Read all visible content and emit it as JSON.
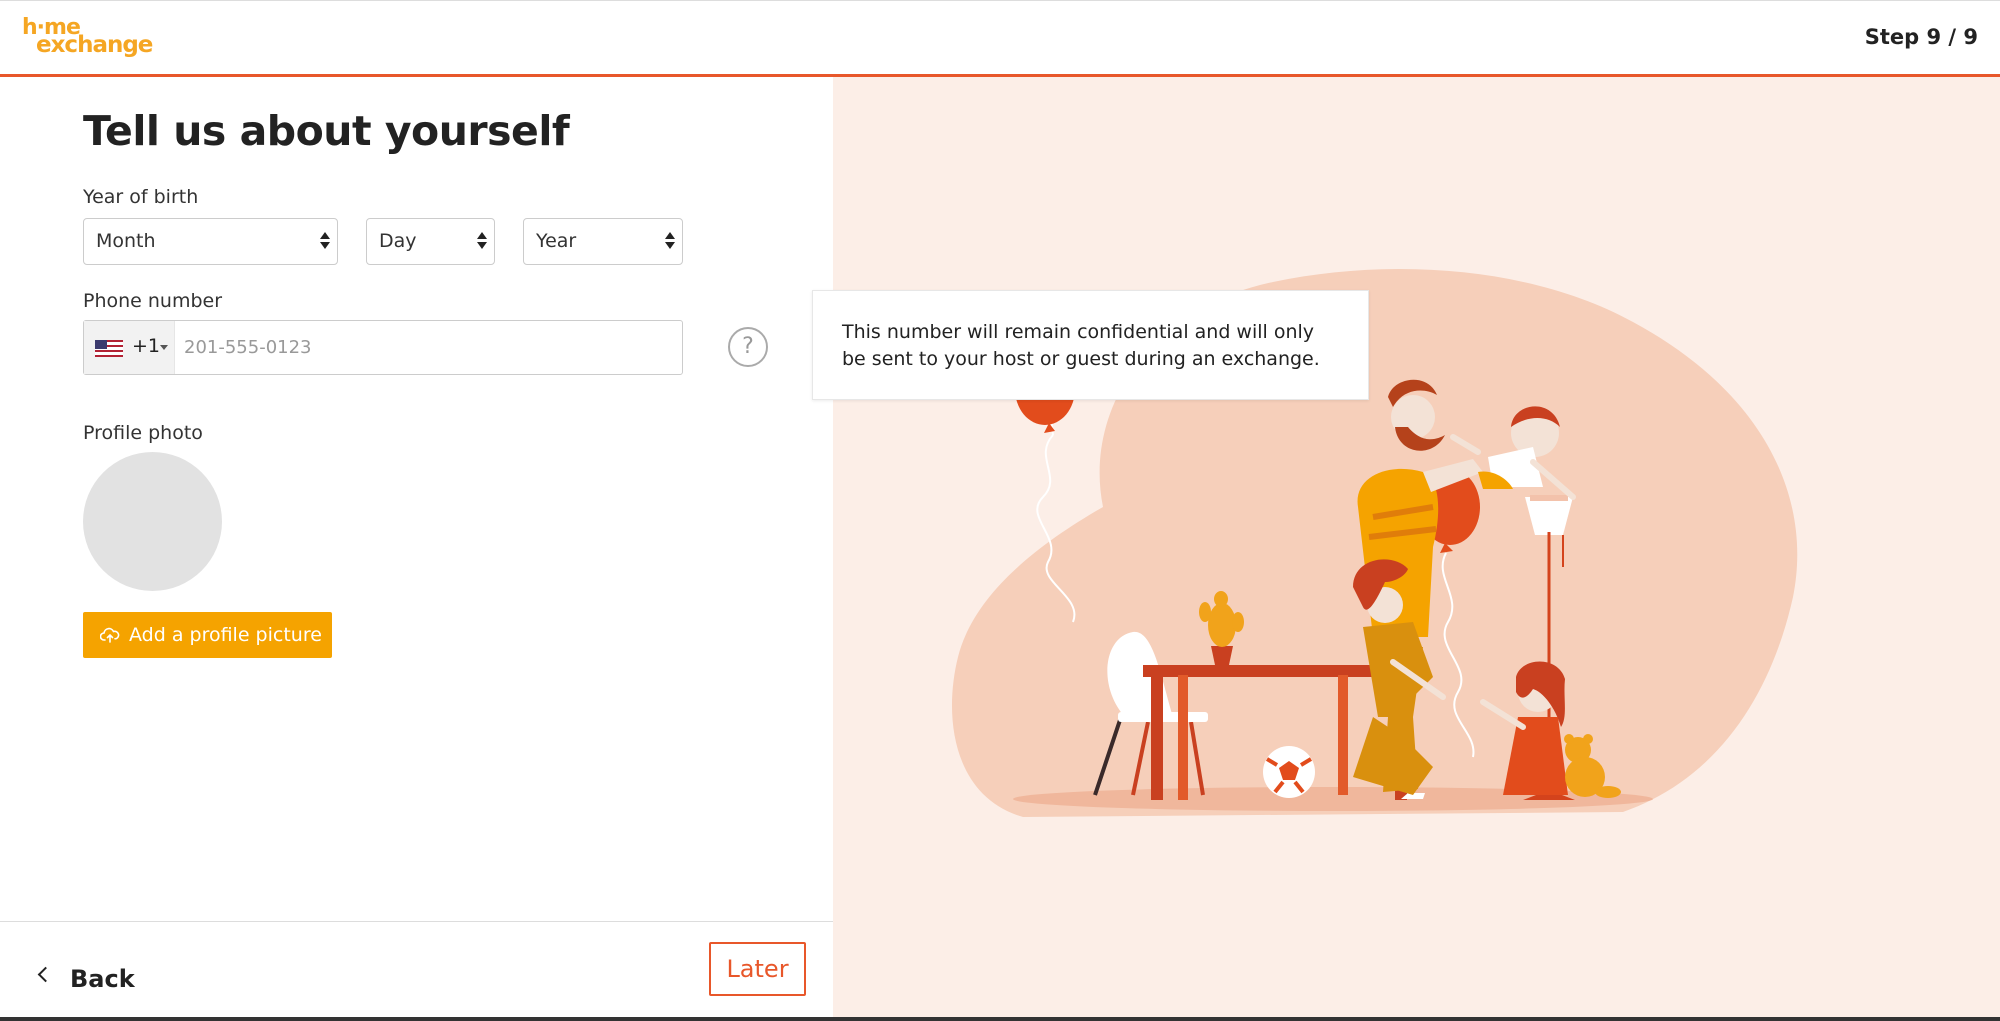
{
  "header": {
    "logo_line1": "h·me",
    "logo_line2": "exchange",
    "step": "Step 9 / 9",
    "accent_color": "#e8572a"
  },
  "form": {
    "title": "Tell us about yourself",
    "birth_label": "Year of birth",
    "month": "Month",
    "day": "Day",
    "year": "Year",
    "phone_label": "Phone number",
    "dial_code": "+1",
    "country_flag": "us-flag-icon",
    "phone_placeholder": "201-555-0123",
    "help_glyph": "?",
    "photo_label": "Profile photo",
    "upload_label": "Add a profile picture",
    "upload_color": "#f5a300"
  },
  "tooltip": {
    "text": "This number will remain confidential and will only be sent to your host or guest during an exchange."
  },
  "footer": {
    "back_label": "Back",
    "later_label": "Later"
  }
}
